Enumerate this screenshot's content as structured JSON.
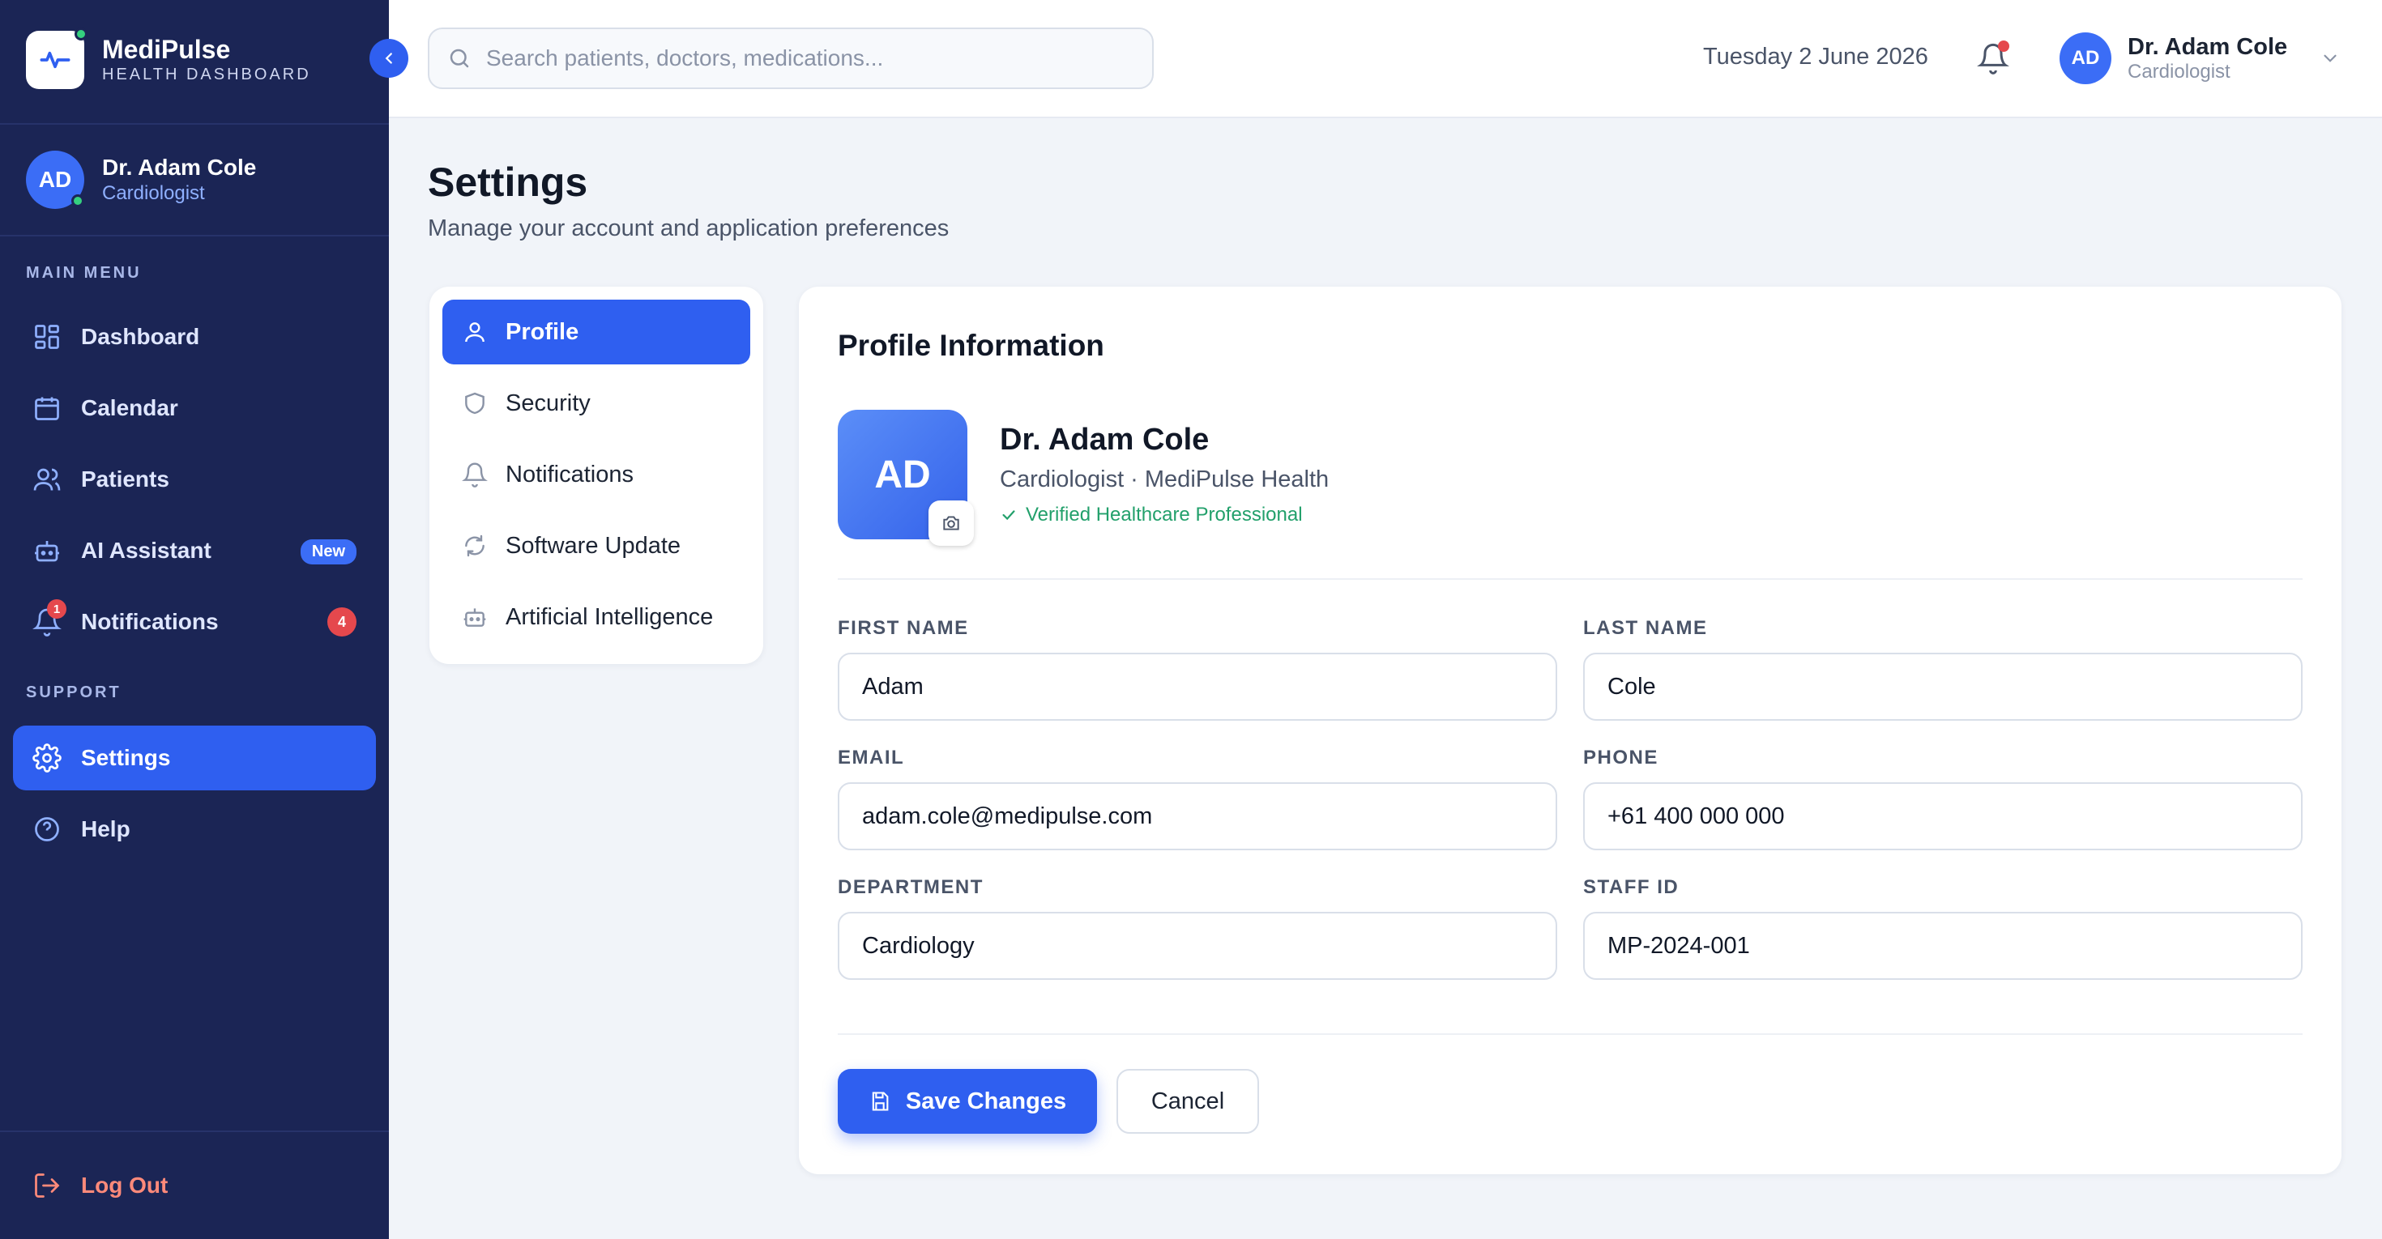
{
  "brand": {
    "name": "MediPulse",
    "subtitle": "HEALTH DASHBOARD"
  },
  "sidebar": {
    "user": {
      "initials": "AD",
      "name": "Dr. Adam Cole",
      "role": "Cardiologist"
    },
    "main_menu_label": "MAIN MENU",
    "support_label": "SUPPORT",
    "items": [
      {
        "label": "Dashboard",
        "icon": "grid-icon"
      },
      {
        "label": "Calendar",
        "icon": "calendar-icon"
      },
      {
        "label": "Patients",
        "icon": "users-icon"
      },
      {
        "label": "AI Assistant",
        "icon": "bot-icon",
        "badge": "New"
      },
      {
        "label": "Notifications",
        "icon": "bell-icon",
        "badge": "4",
        "icon_badge": "1"
      }
    ],
    "support_items": [
      {
        "label": "Settings",
        "icon": "gear-icon",
        "active": true
      },
      {
        "label": "Help",
        "icon": "help-icon"
      }
    ],
    "logout_label": "Log Out"
  },
  "header": {
    "search_placeholder": "Search patients, doctors, medications...",
    "date": "Tuesday 2 June 2026",
    "user": {
      "initials": "AD",
      "name": "Dr. Adam Cole",
      "role": "Cardiologist"
    }
  },
  "page": {
    "title": "Settings",
    "subtitle": "Manage your account and application preferences"
  },
  "settings_nav": [
    {
      "label": "Profile",
      "icon": "user-icon",
      "active": true
    },
    {
      "label": "Security",
      "icon": "shield-icon"
    },
    {
      "label": "Notifications",
      "icon": "bell-icon"
    },
    {
      "label": "Software Update",
      "icon": "refresh-icon"
    },
    {
      "label": "Artificial Intelligence",
      "icon": "bot-icon"
    }
  ],
  "profile": {
    "section_title": "Profile Information",
    "initials": "AD",
    "name": "Dr. Adam Cole",
    "role_line": "Cardiologist · MediPulse Health",
    "verified": "Verified Healthcare Professional",
    "fields": {
      "first_name": {
        "label": "FIRST NAME",
        "value": "Adam"
      },
      "last_name": {
        "label": "LAST NAME",
        "value": "Cole"
      },
      "email": {
        "label": "EMAIL",
        "value": "adam.cole@medipulse.com"
      },
      "phone": {
        "label": "PHONE",
        "value": "+61 400 000 000"
      },
      "department": {
        "label": "DEPARTMENT",
        "value": "Cardiology"
      },
      "staff_id": {
        "label": "STAFF ID",
        "value": "MP-2024-001"
      }
    },
    "save_label": "Save Changes",
    "cancel_label": "Cancel"
  },
  "colors": {
    "sidebar": "#1b2555",
    "accent": "#2f5ff0",
    "danger": "#e5484d",
    "success": "#22a06b"
  }
}
